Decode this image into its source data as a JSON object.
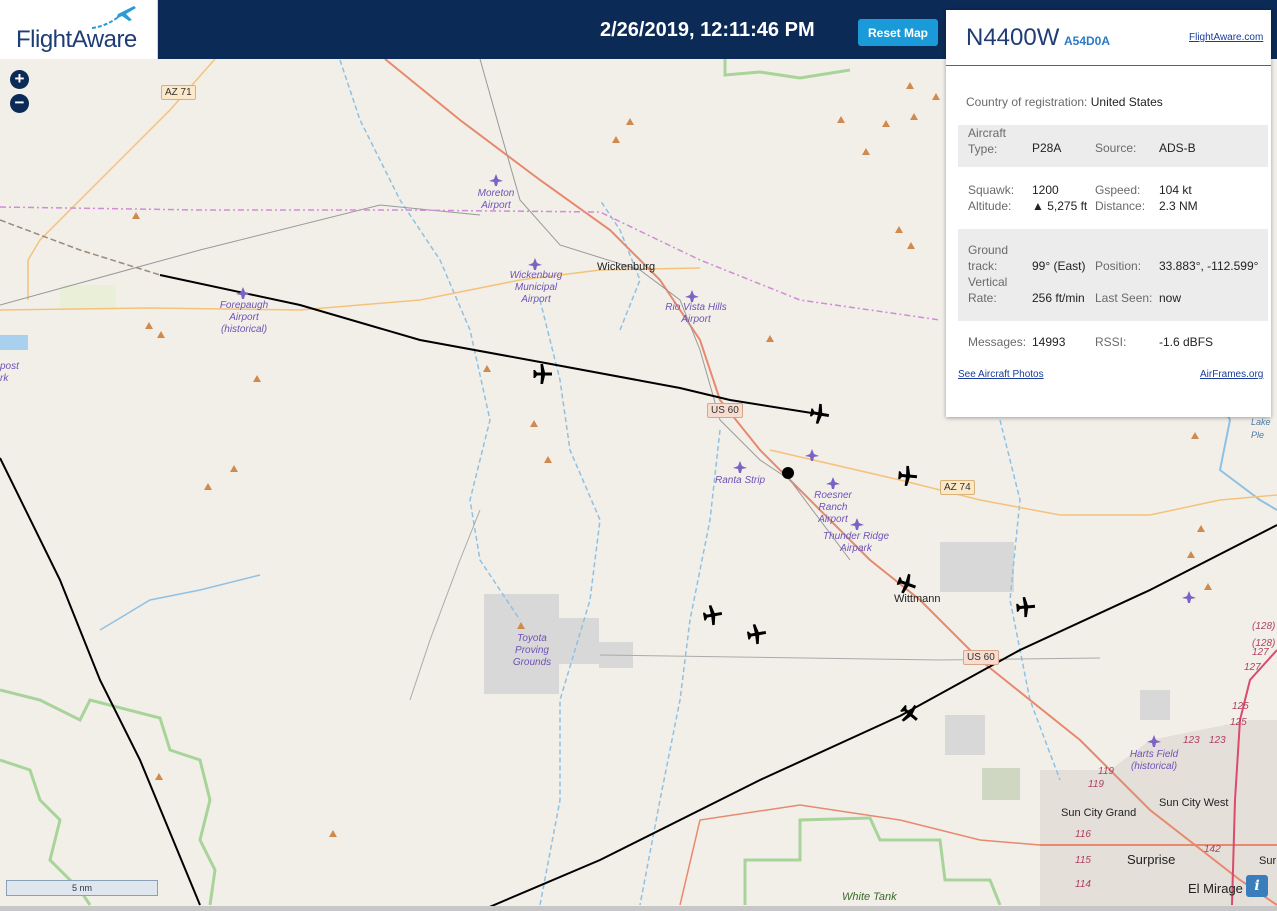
{
  "header": {
    "brand": "FlightAware",
    "clock": "2/26/2019, 12:11:46 PM",
    "reset_label": "Reset Map"
  },
  "map": {
    "zoom_in": "+",
    "zoom_out": "−",
    "scale_label": "5 nm",
    "info_label": "i",
    "shields": [
      "AZ 71",
      "US 60",
      "AZ 74",
      "US 60"
    ],
    "places": {
      "wickenburg": "Wickenburg",
      "wittmann": "Wittmann",
      "surprise": "Surprise",
      "sun_city_grand": "Sun City Grand",
      "sun_city_west": "Sun City West",
      "el_mirage": "El Mirage",
      "white_tank": "White Tank",
      "lake": "Lake Ple",
      "sun": "Sur"
    },
    "airports": {
      "moreton": "Moreton Airport",
      "wickenburg_muni": "Wickenburg Municipal Airport",
      "forepaugh": "Forepaugh Airport (historical)",
      "rio_vista": "Rio Vista Hills Airport",
      "ranta": "Ranta Strip",
      "roesner": "Roesner Ranch Airport",
      "thunder_ridge": "Thunder Ridge Airpark",
      "toyota": "Toyota Proving Grounds",
      "harts": "Harts Field (historical)",
      "edge": "post rk"
    },
    "route_numbers": [
      "(128)",
      "(128)",
      "127",
      "127",
      "125",
      "125",
      "123",
      "123",
      "119",
      "119",
      "116",
      "115",
      "114",
      "142"
    ]
  },
  "panel": {
    "tail": "N4400W",
    "hex": "A54D0A",
    "fa_link": "FlightAware.com",
    "country_label": "Country of registration:",
    "country_value": "United States",
    "aircraft_type_label": "Aircraft Type:",
    "aircraft_type_value": "P28A",
    "source_label": "Source:",
    "source_value": "ADS-B",
    "squawk_label": "Squawk:",
    "squawk_value": "1200",
    "gspeed_label": "Gspeed:",
    "gspeed_value": "104 kt",
    "altitude_label": "Altitude:",
    "altitude_value": "▲ 5,275 ft",
    "distance_label": "Distance:",
    "distance_value": "2.3 NM",
    "ground_track_label": "Ground track:",
    "ground_track_value": "99° (East)",
    "position_label": "Position:",
    "position_value": "33.883°, -112.599°",
    "vertical_rate_label": "Vertical Rate:",
    "vertical_rate_value": "256 ft/min",
    "last_seen_label": "Last Seen:",
    "last_seen_value": "now",
    "messages_label": "Messages:",
    "messages_value": "14993",
    "rssi_label": "RSSI:",
    "rssi_value": "-1.6 dBFS",
    "photos_link": "See Aircraft Photos",
    "airframes_link": "AirFrames.org"
  },
  "colors": {
    "header_bg": "#0b2a55",
    "accent": "#1a9ad9",
    "map_bg": "#f2efe9",
    "highway": "#e8896e",
    "secondary_road": "#f5c27a",
    "water": "#8fc1e3",
    "boundary": "#d28bd8",
    "track": "#000000"
  }
}
